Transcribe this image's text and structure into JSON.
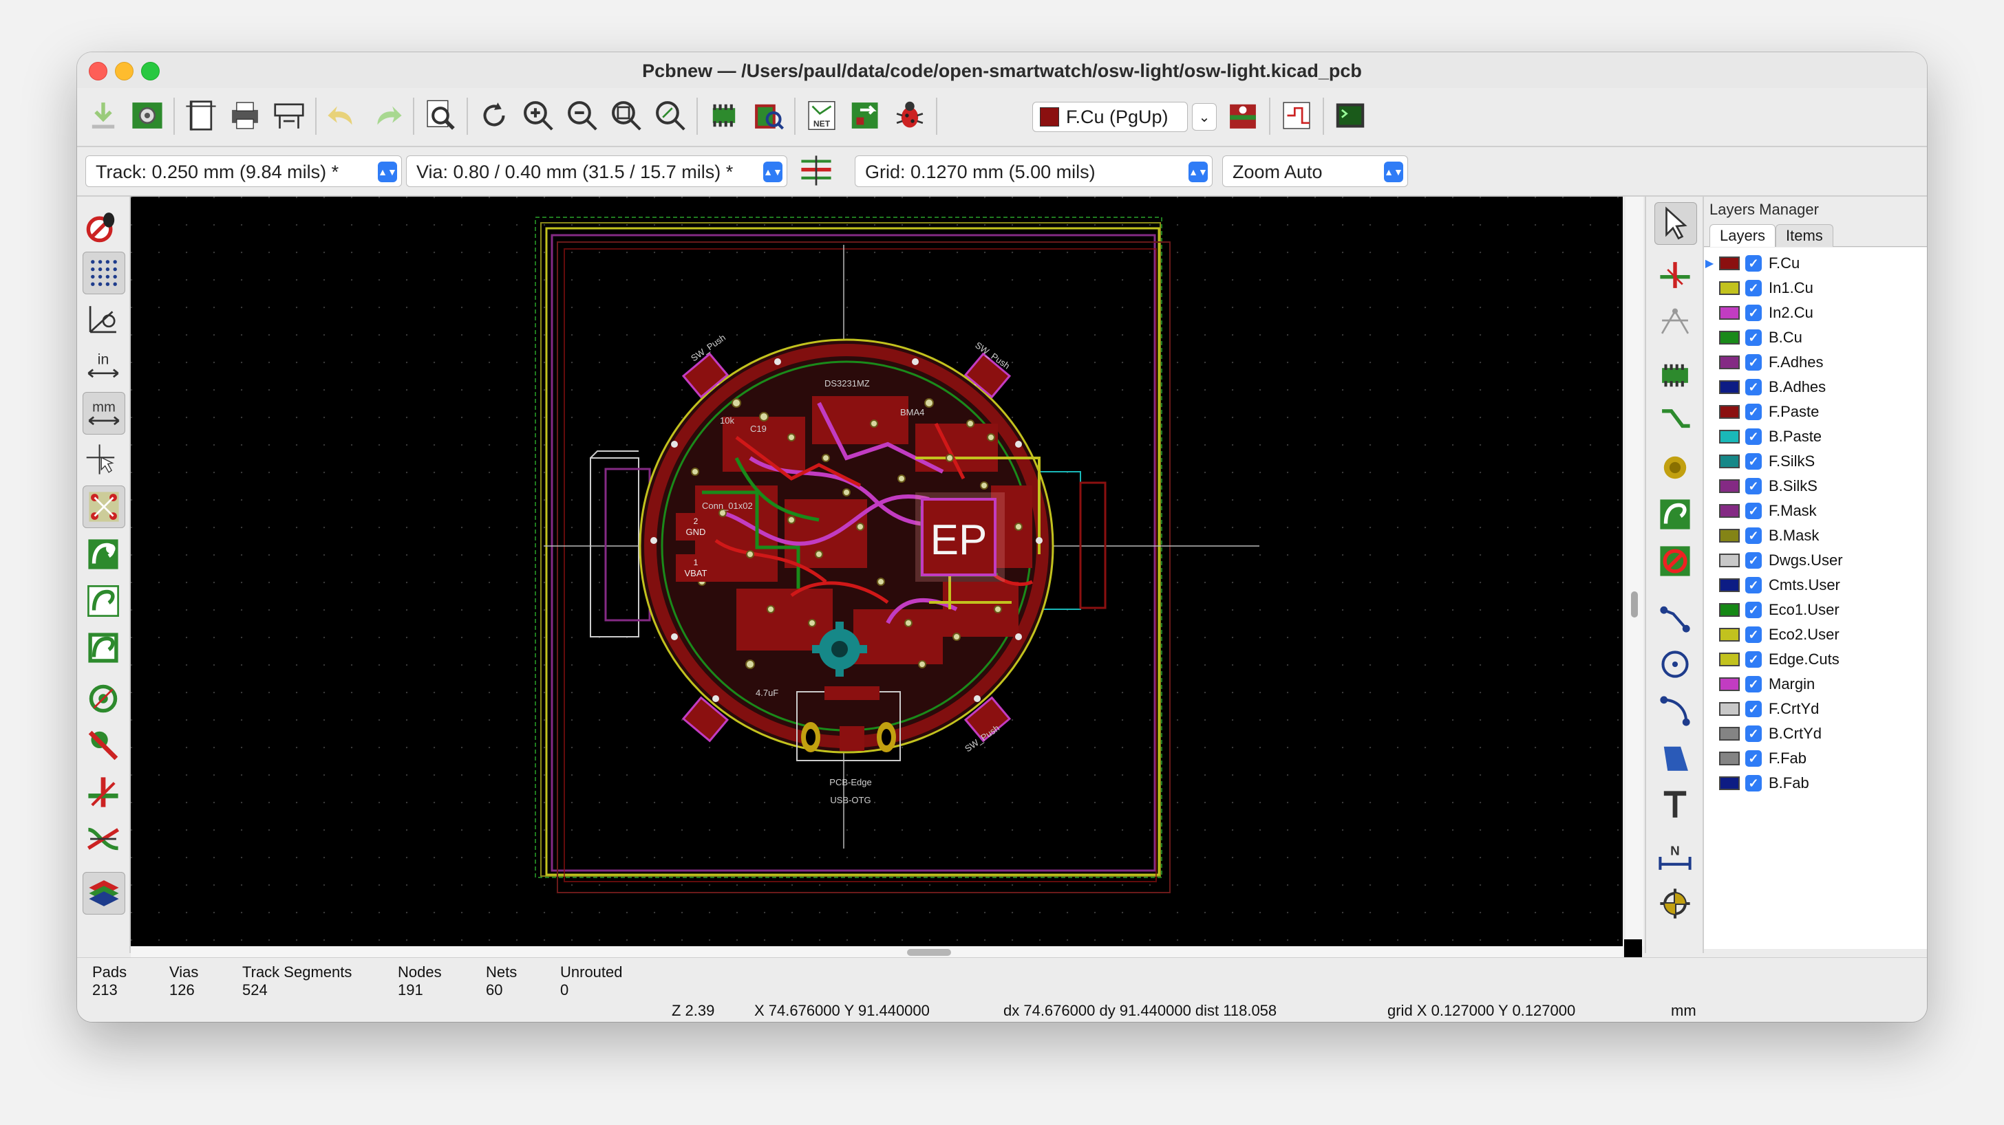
{
  "window": {
    "title": "Pcbnew — /Users/paul/data/code/open-smartwatch/osw-light/osw-light.kicad_pcb"
  },
  "main_toolbar": {
    "active_layer": "F.Cu (PgUp)",
    "active_layer_color": "#8b1010",
    "icons": [
      "download-icon",
      "board-setup-icon",
      "page-settings-icon",
      "print-icon",
      "plot-icon",
      "undo-icon",
      "redo-icon",
      "find-icon",
      "refresh-icon",
      "zoom-in-icon",
      "zoom-out-icon",
      "zoom-fit-icon",
      "zoom-selection-icon",
      "footprint-editor-icon",
      "footprint-viewer-icon",
      "netlist-icon",
      "update-pcb-icon",
      "drc-bug-icon",
      "layer-pair-icon",
      "microwave-icon",
      "scripting-console-icon"
    ]
  },
  "aux_toolbar": {
    "track": "Track: 0.250 mm (9.84 mils) *",
    "via": "Via: 0.80 / 0.40 mm (31.5 / 15.7 mils) *",
    "grid": "Grid: 0.1270 mm (5.00 mils)",
    "zoom": "Zoom Auto"
  },
  "pcb": {
    "ep_label": "EP",
    "silkscreen": [
      "SW_Push",
      "SW_Push",
      "SW_Push",
      "SW_Push",
      "DS3231MZ",
      "BMA4",
      "GND",
      "VBAT",
      "PCB-Edge",
      "USB-OTG",
      "C19",
      "10k",
      "4.7uF",
      "Conn_01x02",
      "2",
      "1"
    ]
  },
  "layers_manager": {
    "title": "Layers Manager",
    "tabs": [
      "Layers",
      "Items"
    ],
    "layers": [
      {
        "name": "F.Cu",
        "color": "#8b1010"
      },
      {
        "name": "In1.Cu",
        "color": "#c2c21e"
      },
      {
        "name": "In2.Cu",
        "color": "#c23cc2"
      },
      {
        "name": "B.Cu",
        "color": "#1a8a1a"
      },
      {
        "name": "F.Adhes",
        "color": "#842a84"
      },
      {
        "name": "B.Adhes",
        "color": "#0d1c84"
      },
      {
        "name": "F.Paste",
        "color": "#8b1010"
      },
      {
        "name": "B.Paste",
        "color": "#1ab8b8"
      },
      {
        "name": "F.SilkS",
        "color": "#168888"
      },
      {
        "name": "B.SilkS",
        "color": "#842a84"
      },
      {
        "name": "F.Mask",
        "color": "#842a84"
      },
      {
        "name": "B.Mask",
        "color": "#848416"
      },
      {
        "name": "Dwgs.User",
        "color": "#c8c8c8"
      },
      {
        "name": "Cmts.User",
        "color": "#0d1c84"
      },
      {
        "name": "Eco1.User",
        "color": "#168816"
      },
      {
        "name": "Eco2.User",
        "color": "#c2c21e"
      },
      {
        "name": "Edge.Cuts",
        "color": "#c2c21e"
      },
      {
        "name": "Margin",
        "color": "#c23cc2"
      },
      {
        "name": "F.CrtYd",
        "color": "#c8c8c8"
      },
      {
        "name": "B.CrtYd",
        "color": "#848484"
      },
      {
        "name": "F.Fab",
        "color": "#848484"
      },
      {
        "name": "B.Fab",
        "color": "#0d1c84"
      }
    ]
  },
  "status": {
    "pads_label": "Pads",
    "pads": "213",
    "vias_label": "Vias",
    "vias": "126",
    "tracks_label": "Track Segments",
    "tracks": "524",
    "nodes_label": "Nodes",
    "nodes": "191",
    "nets_label": "Nets",
    "nets": "60",
    "unrouted_label": "Unrouted",
    "unrouted": "0",
    "zoom": "Z 2.39",
    "xy": "X 74.676000  Y 91.440000",
    "delta": "dx 74.676000  dy 91.440000  dist 118.058",
    "grid": "grid X 0.127000  Y 0.127000",
    "units": "mm"
  }
}
